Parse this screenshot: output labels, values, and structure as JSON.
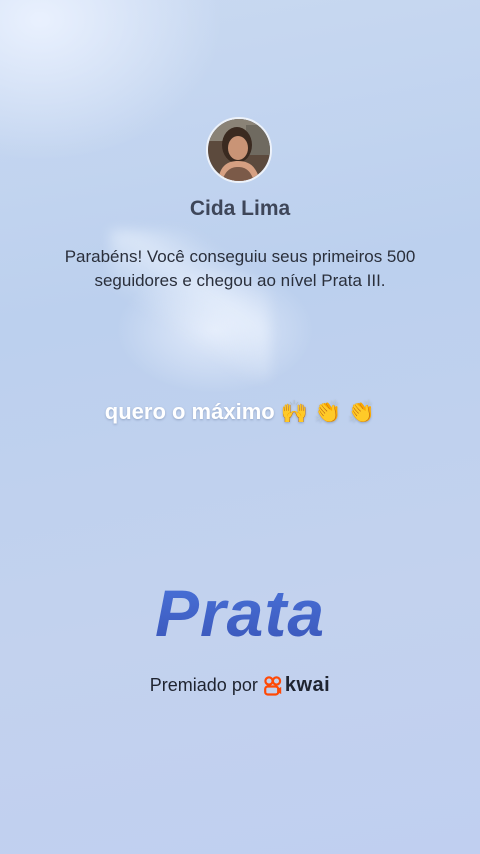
{
  "profile": {
    "name": "Cida Lima",
    "avatar_alt": "profile-photo"
  },
  "achievement": {
    "message": "Parabéns! Você conseguiu seus primeiros 500 seguidores e chegou ao nível Prata III.",
    "level": "Prata"
  },
  "comment": {
    "text": "quero o máximo 🙌 👏 👏"
  },
  "sponsor": {
    "label": "Premiado por",
    "brand": "kwai",
    "brand_color": "#ff4906"
  },
  "colors": {
    "level_text": "#3f62c8",
    "background": "#c3d3ef"
  }
}
